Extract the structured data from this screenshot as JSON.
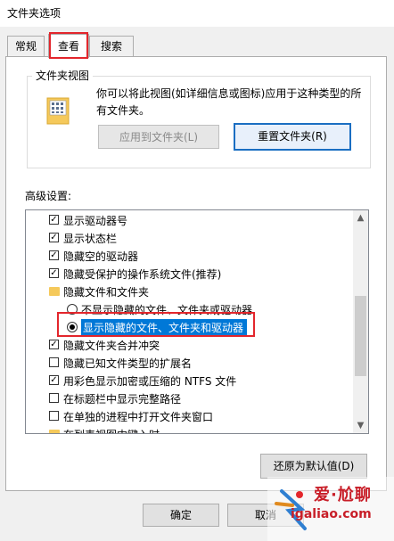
{
  "window": {
    "title": "文件夹选项"
  },
  "tabs": [
    {
      "label": "常规"
    },
    {
      "label": "查看"
    },
    {
      "label": "搜索"
    }
  ],
  "folder_views": {
    "legend": "文件夹视图",
    "description": "你可以将此视图(如详细信息或图标)应用于这种类型的所有文件夹。",
    "apply_label": "应用到文件夹(L)",
    "reset_label": "重置文件夹(R)"
  },
  "advanced": {
    "label": "高级设置:",
    "items": [
      {
        "type": "checkbox",
        "checked": true,
        "indent": 0,
        "label": "显示驱动器号"
      },
      {
        "type": "checkbox",
        "checked": true,
        "indent": 0,
        "label": "显示状态栏"
      },
      {
        "type": "checkbox",
        "checked": true,
        "indent": 0,
        "label": "隐藏空的驱动器"
      },
      {
        "type": "checkbox",
        "checked": true,
        "indent": 0,
        "label": "隐藏受保护的操作系统文件(推荐)"
      },
      {
        "type": "folder",
        "checked": false,
        "indent": 0,
        "label": "隐藏文件和文件夹"
      },
      {
        "type": "radio",
        "checked": false,
        "indent": 1,
        "label": "不显示隐藏的文件、文件夹或驱动器"
      },
      {
        "type": "radio",
        "checked": true,
        "indent": 1,
        "label": "显示隐藏的文件、文件夹和驱动器",
        "selected": true
      },
      {
        "type": "checkbox",
        "checked": true,
        "indent": 0,
        "label": "隐藏文件夹合并冲突"
      },
      {
        "type": "checkbox",
        "checked": false,
        "indent": 0,
        "label": "隐藏已知文件类型的扩展名"
      },
      {
        "type": "checkbox",
        "checked": true,
        "indent": 0,
        "label": "用彩色显示加密或压缩的 NTFS 文件"
      },
      {
        "type": "checkbox",
        "checked": false,
        "indent": 0,
        "label": "在标题栏中显示完整路径"
      },
      {
        "type": "checkbox",
        "checked": false,
        "indent": 0,
        "label": "在单独的进程中打开文件夹窗口"
      },
      {
        "type": "folder",
        "checked": false,
        "indent": 0,
        "label": "在列表视图中键入时"
      }
    ]
  },
  "buttons": {
    "restore_label": "还原为默认值(D)",
    "ok_label": "确定",
    "cancel_label": "取消"
  },
  "watermark": {
    "brand": "爱·尬聊",
    "site": "igaliao.com"
  },
  "colors": {
    "highlight_red": "#e3262c",
    "selection_blue": "#0078d7",
    "accent_blue": "#1a6ec2"
  }
}
